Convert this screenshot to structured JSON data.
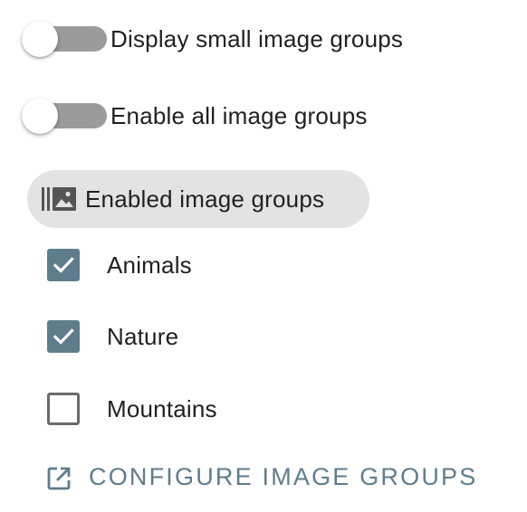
{
  "toggles": [
    {
      "label": "Display small image groups",
      "on": false
    },
    {
      "label": "Enable all image groups",
      "on": false
    }
  ],
  "section": {
    "icon": "photo-library-icon",
    "label": "Enabled image groups"
  },
  "groups": [
    {
      "label": "Animals",
      "checked": true
    },
    {
      "label": "Nature",
      "checked": true
    },
    {
      "label": "Mountains",
      "checked": false
    }
  ],
  "configure": {
    "icon": "open-in-new-icon",
    "label": "CONFIGURE IMAGE GROUPS"
  },
  "colors": {
    "accent": "#5e7d8c",
    "toggle_track_off": "#9b9b9b",
    "chip_background": "#e3e3e3"
  }
}
